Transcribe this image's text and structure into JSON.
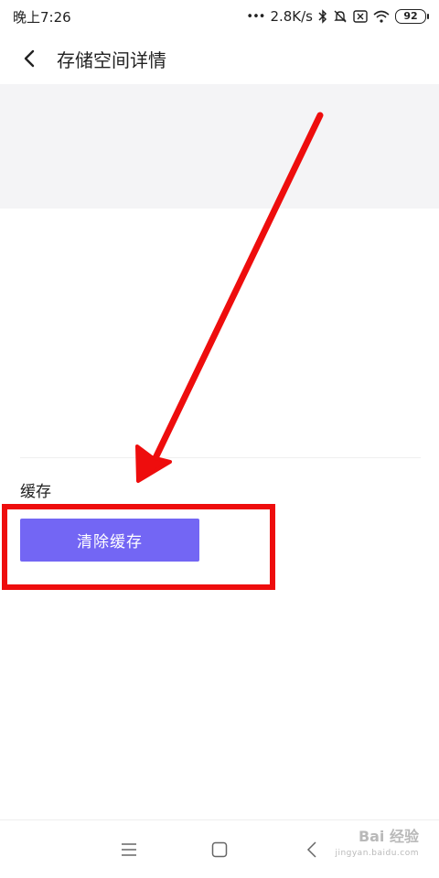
{
  "status_bar": {
    "time": "晚上7:26",
    "dots": "•••",
    "network_speed": "2.8K/s",
    "battery": "92",
    "icons": [
      "bluetooth-icon",
      "mute-icon",
      "sim-x-icon",
      "wifi-icon",
      "battery-icon"
    ]
  },
  "header": {
    "back_icon": "chevron-left-icon",
    "title": "存储空间详情"
  },
  "cache": {
    "label": "缓存",
    "clear_button_label": "清除缓存"
  },
  "nav_bar": {
    "icons": [
      "menu-icon",
      "home-icon",
      "back-icon"
    ]
  },
  "watermark": {
    "brand": "Bai 经验",
    "url": "jingyan.baidu.com"
  },
  "colors": {
    "button": "#7366f4",
    "annotation": "#ee0d0d",
    "banner": "#f4f4f6"
  }
}
